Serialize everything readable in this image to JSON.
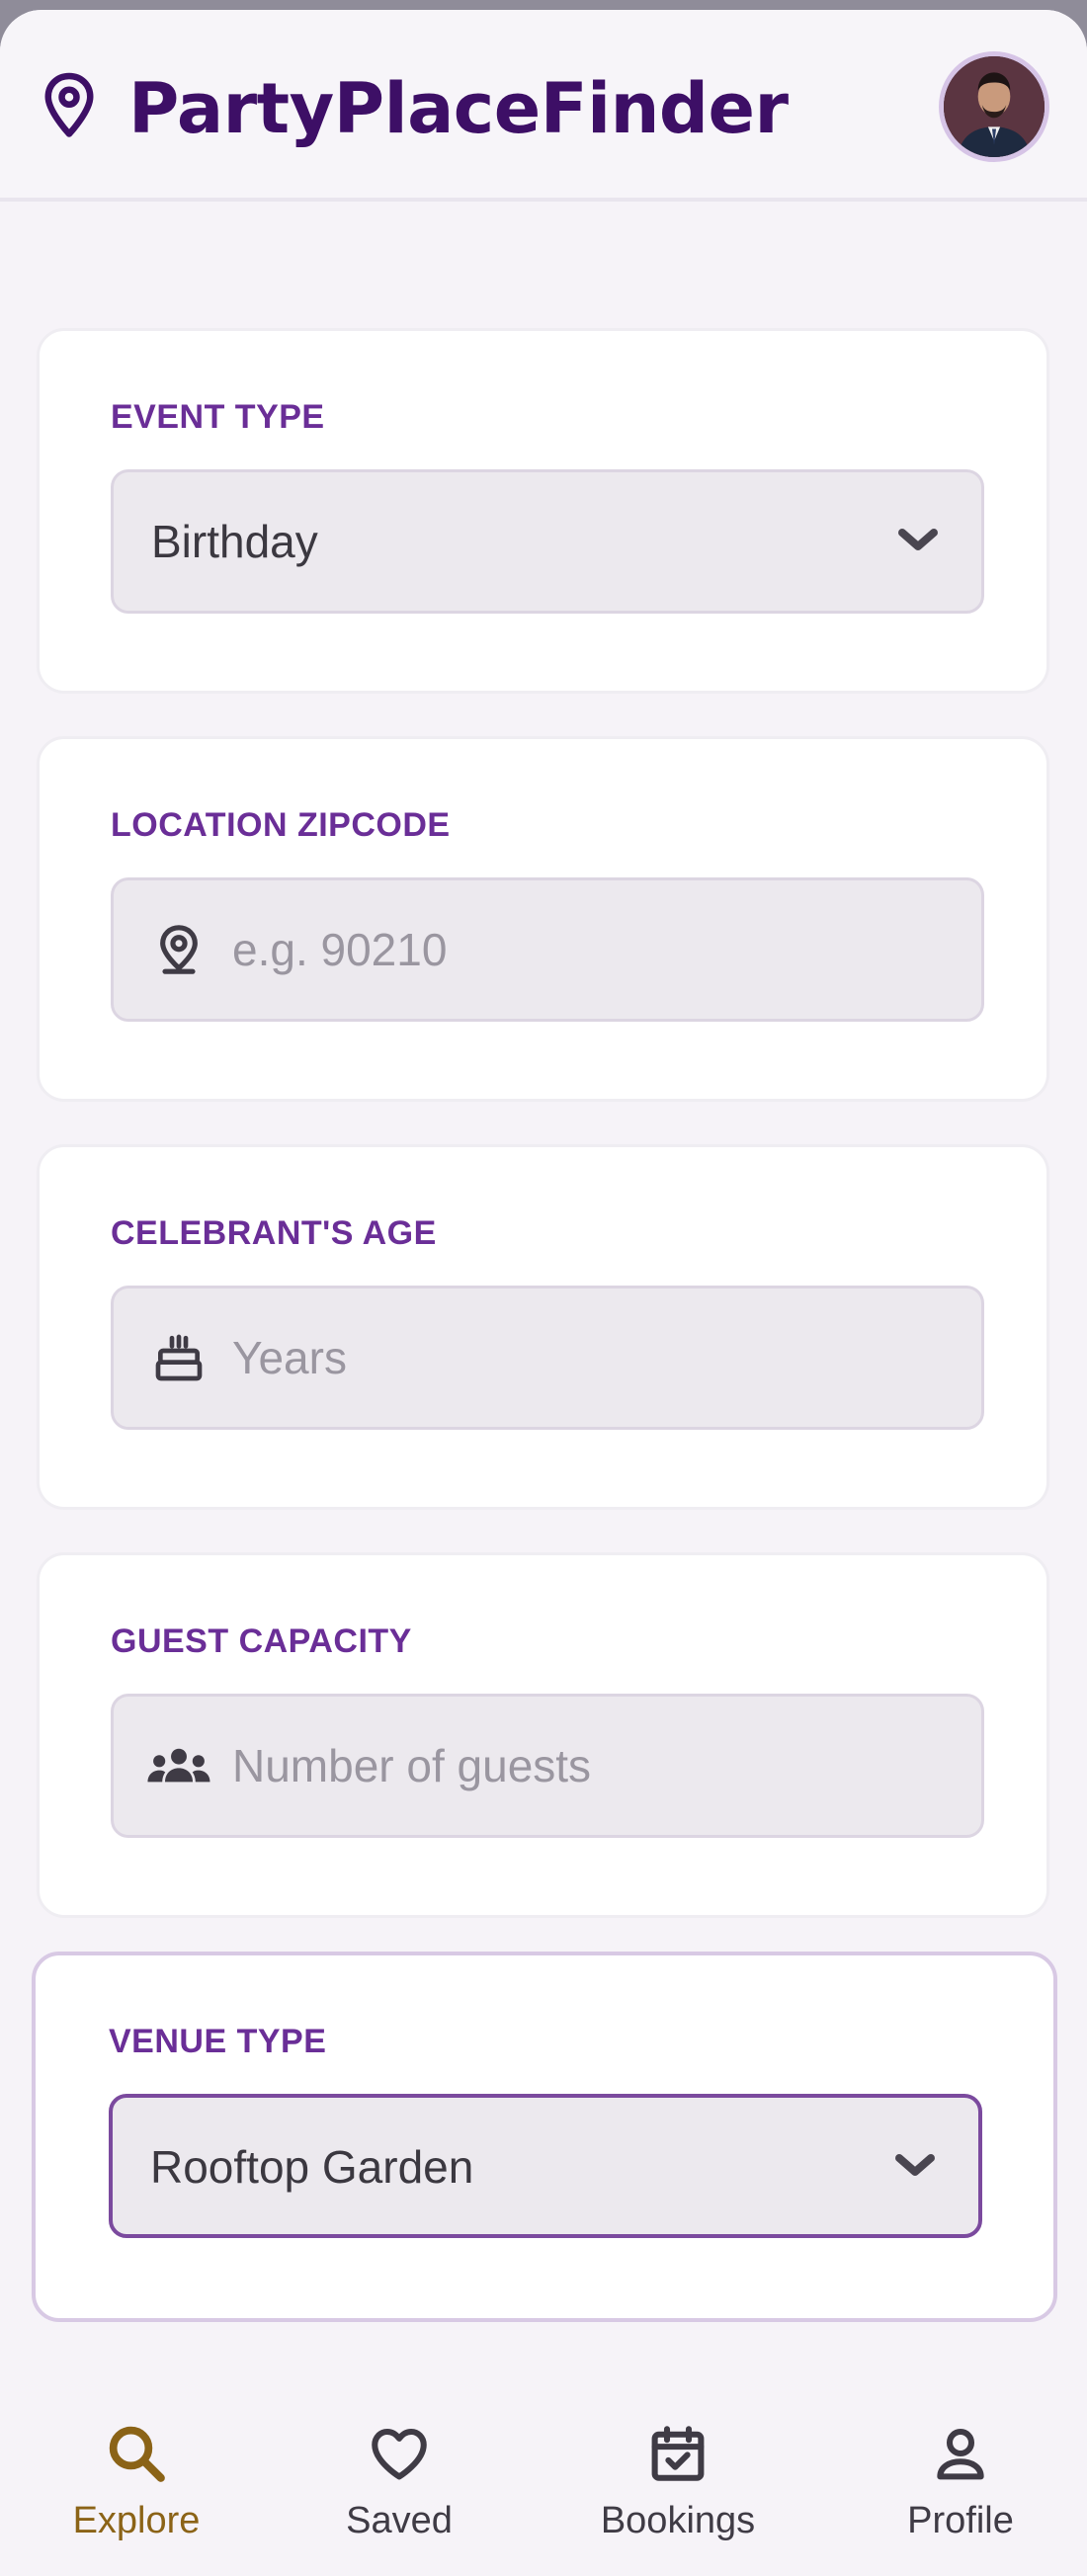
{
  "header": {
    "app_name": "PartyPlaceFinder",
    "logo_icon": "map-pin-icon",
    "avatar": "user-avatar"
  },
  "form": {
    "event_type": {
      "label": "EVENT TYPE",
      "value": "Birthday"
    },
    "location_zipcode": {
      "label": "LOCATION ZIPCODE",
      "placeholder": "e.g. 90210",
      "icon": "map-pin-icon"
    },
    "celebrant_age": {
      "label": "CELEBRANT'S AGE",
      "placeholder": "Years",
      "icon": "cake-icon"
    },
    "guest_capacity": {
      "label": "GUEST CAPACITY",
      "placeholder": "Number of guests",
      "icon": "group-icon"
    },
    "venue_type": {
      "label": "VENUE TYPE",
      "value": "Rooftop Garden"
    }
  },
  "nav": {
    "items": [
      {
        "label": "Explore",
        "icon": "search-icon",
        "active": true
      },
      {
        "label": "Saved",
        "icon": "heart-icon"
      },
      {
        "label": "Bookings",
        "icon": "calendar-check-icon"
      },
      {
        "label": "Profile",
        "icon": "user-icon"
      }
    ]
  },
  "colors": {
    "brand": "#3d0f66",
    "label": "#6a2e97",
    "active_nav": "#8b6317",
    "field_bg": "#ece9ee"
  }
}
